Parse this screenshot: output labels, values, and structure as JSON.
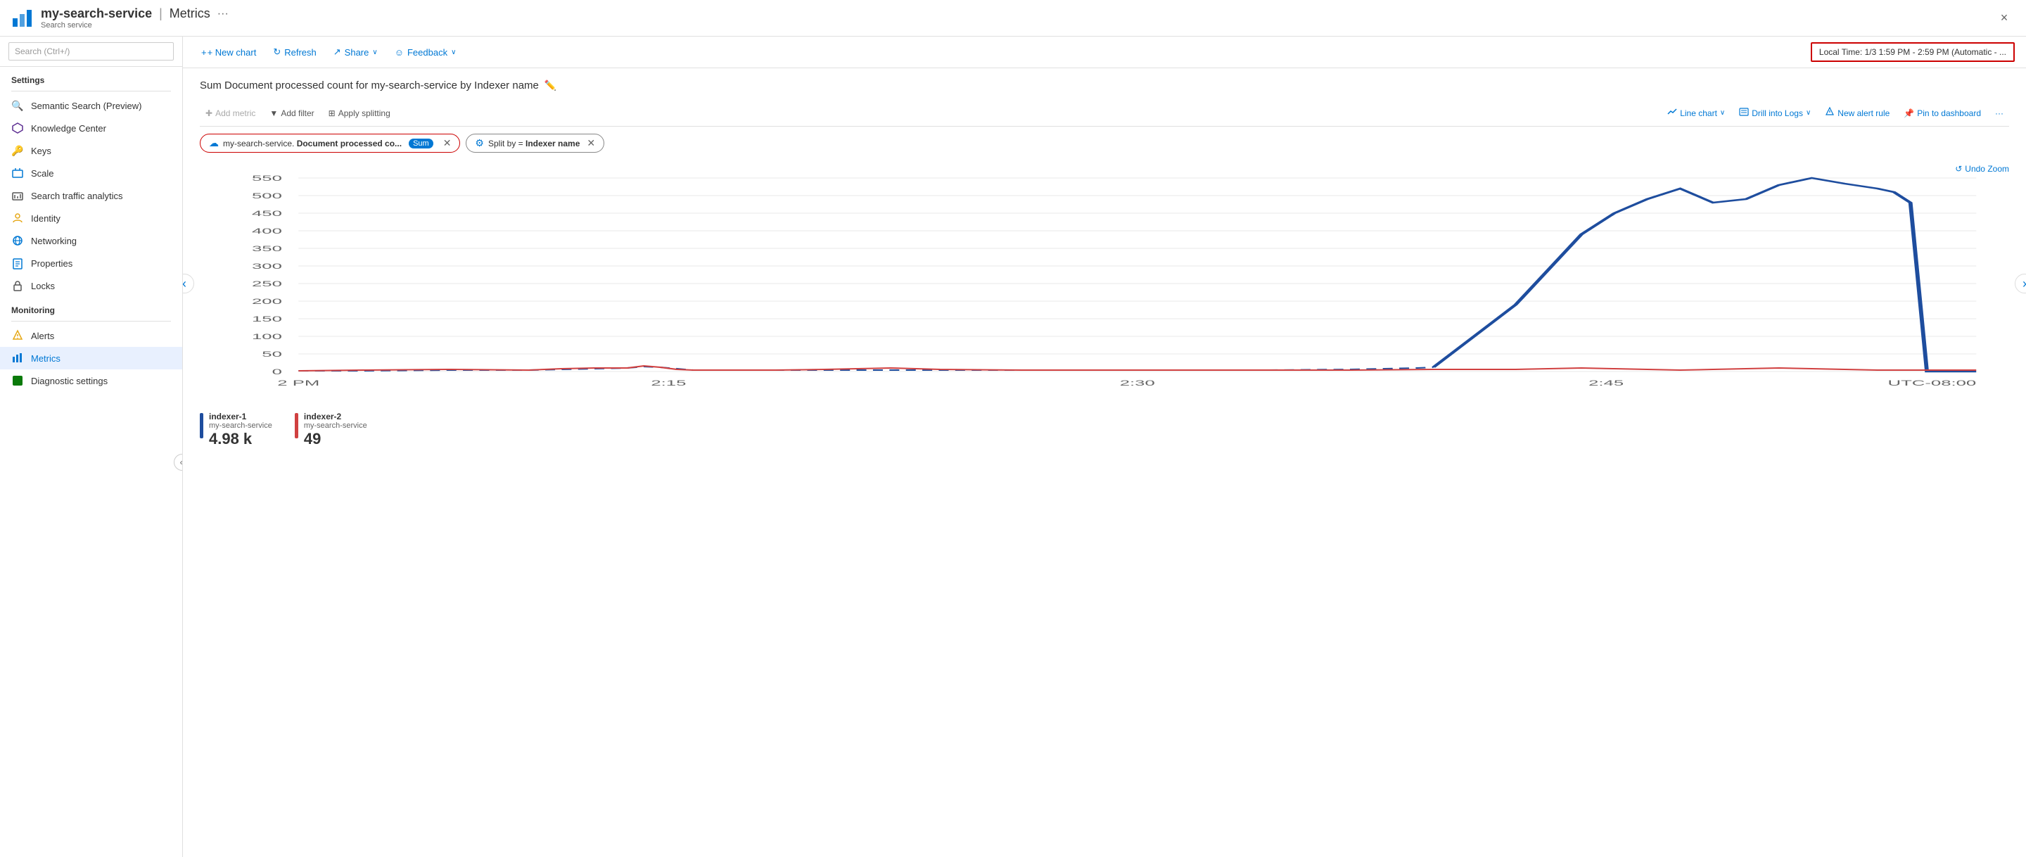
{
  "titleBar": {
    "icon": "📊",
    "serviceName": "my-search-service",
    "separator": "|",
    "pageTitle": "Metrics",
    "more": "···",
    "subtitle": "Search service",
    "closeLabel": "×"
  },
  "sidebar": {
    "searchPlaceholder": "Search (Ctrl+/)",
    "collapseIcon": "«",
    "sections": [
      {
        "label": "Settings",
        "items": [
          {
            "id": "semantic-search",
            "icon": "🔍",
            "label": "Semantic Search (Preview)",
            "active": false
          },
          {
            "id": "knowledge-center",
            "icon": "💠",
            "label": "Knowledge Center",
            "active": false
          },
          {
            "id": "keys",
            "icon": "🔑",
            "label": "Keys",
            "active": false
          },
          {
            "id": "scale",
            "icon": "📋",
            "label": "Scale",
            "active": false
          },
          {
            "id": "search-traffic",
            "icon": "📊",
            "label": "Search traffic analytics",
            "active": false
          },
          {
            "id": "identity",
            "icon": "🔒",
            "label": "Identity",
            "active": false
          },
          {
            "id": "networking",
            "icon": "🌐",
            "label": "Networking",
            "active": false
          },
          {
            "id": "properties",
            "icon": "📄",
            "label": "Properties",
            "active": false
          },
          {
            "id": "locks",
            "icon": "🔐",
            "label": "Locks",
            "active": false
          }
        ]
      },
      {
        "label": "Monitoring",
        "items": [
          {
            "id": "alerts",
            "icon": "🔔",
            "label": "Alerts",
            "active": false
          },
          {
            "id": "metrics",
            "icon": "📈",
            "label": "Metrics",
            "active": true
          },
          {
            "id": "diagnostic",
            "icon": "🟩",
            "label": "Diagnostic settings",
            "active": false
          }
        ]
      }
    ]
  },
  "toolbar": {
    "newChart": "+ New chart",
    "refresh": "↻ Refresh",
    "share": "↗ Share",
    "shareArrow": "∨",
    "feedback": "☺ Feedback",
    "feedbackArrow": "∨",
    "timePicker": "Local Time: 1/3 1:59 PM - 2:59 PM (Automatic - ..."
  },
  "chartTitle": "Sum Document processed count for my-search-service by Indexer name",
  "chartToolbar": {
    "addMetric": "+ Add metric",
    "addFilter": "▼ Add filter",
    "applySplitting": "⊞ Apply splitting",
    "lineChart": "📈 Line chart",
    "lineChartArrow": "∨",
    "drillIntoLogs": "📋 Drill into Logs",
    "drillArrow": "∨",
    "newAlertRule": "🔔 New alert rule",
    "pinToDashboard": "📌 Pin to dashboard",
    "more": "···"
  },
  "filters": {
    "metric": {
      "icon": "☁",
      "label": "my-search-service. Document processed co...",
      "badge": "Sum"
    },
    "split": {
      "icon": "⚙",
      "label": "Split by = Indexer name"
    }
  },
  "chart": {
    "undoZoom": "↺ Undo Zoom",
    "yLabels": [
      "550",
      "500",
      "450",
      "400",
      "350",
      "300",
      "250",
      "200",
      "150",
      "100",
      "50",
      "0"
    ],
    "xLabels": [
      "2 PM",
      "2:15",
      "2:30",
      "2:45",
      "UTC-08:00"
    ],
    "navLeft": "‹",
    "navRight": "›"
  },
  "legend": [
    {
      "id": "indexer-1",
      "color": "#1e4d9e",
      "name": "indexer-1",
      "sub": "my-search-service",
      "value": "4.98 k"
    },
    {
      "id": "indexer-2",
      "color": "#d04040",
      "name": "indexer-2",
      "sub": "my-search-service",
      "value": "49"
    }
  ]
}
